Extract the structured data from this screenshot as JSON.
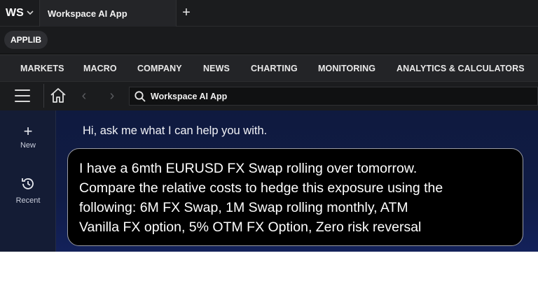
{
  "titlebar": {
    "logo": "WS",
    "tab_title": "Workspace AI App",
    "new_tab_icon": "plus-icon"
  },
  "applib": {
    "label": "APPLIB"
  },
  "menu": {
    "items": [
      "MARKETS",
      "MACRO",
      "COMPANY",
      "NEWS",
      "CHARTING",
      "MONITORING",
      "ANALYTICS & CALCULATORS"
    ]
  },
  "toolbar": {
    "search_value": "Workspace AI App"
  },
  "sidebar": {
    "new_label": "New",
    "recent_label": "Recent"
  },
  "chat": {
    "greeting": "Hi, ask me what I can help you with.",
    "user_message": "I have a 6mth EURUSD FX Swap rolling over tomorrow.\nCompare the relative costs to hedge this exposure using the\nfollowing: 6M FX Swap, 1M Swap rolling monthly, ATM\nVanilla FX option, 5% OTM FX Option, Zero risk reversal"
  },
  "colors": {
    "chrome": "#1b1c1e",
    "menu_bg": "#232427",
    "sidebar_bg": "#141c35",
    "chat_bg": "#0f1a3f",
    "bubble_bg": "#000000"
  }
}
